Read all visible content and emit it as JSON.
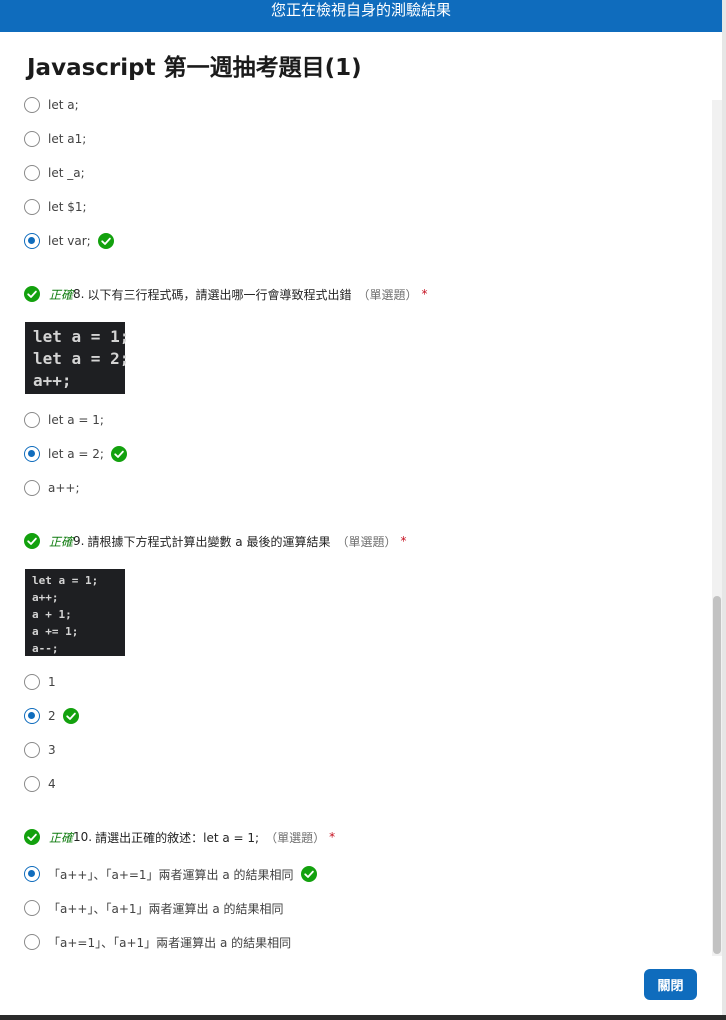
{
  "banner": {
    "text": "您正在檢視自身的測驗結果"
  },
  "title": "Javascript 第一週抽考題目(1)",
  "labels": {
    "correct": "正確",
    "single_choice": "（單選題）",
    "required": "*"
  },
  "q7": {
    "options": [
      "let a;",
      "let a1;",
      "let _a;",
      "let $1;",
      "let var;"
    ],
    "selected_index": 4
  },
  "q8": {
    "number": "8.",
    "text": "以下有三行程式碼，請選出哪一行會導致程式出錯",
    "code": [
      "let a = 1;",
      "let a = 2;",
      "a++;"
    ],
    "options": [
      "let a = 1;",
      "let a = 2;",
      "a++;"
    ],
    "selected_index": 1
  },
  "q9": {
    "number": "9.",
    "text": "請根據下方程式計算出變數 a 最後的運算結果",
    "code": [
      "let a = 1;",
      "a++;",
      "a + 1;",
      "a += 1;",
      "a--;"
    ],
    "options": [
      "1",
      "2",
      "3",
      "4"
    ],
    "selected_index": 1
  },
  "q10": {
    "number": "10.",
    "text": "請選出正確的敘述：let a = 1;",
    "options": [
      "「a++」、「a+=1」兩者運算出 a 的結果相同",
      "「a++」、「a+1」兩者運算出 a 的結果相同",
      "「a+=1」、「a+1」兩者運算出 a 的結果相同"
    ],
    "selected_index": 0
  },
  "close_button": "關閉",
  "colors": {
    "accent": "#0f6cbd",
    "correct": "#13a10e",
    "required": "#c50f1f"
  }
}
